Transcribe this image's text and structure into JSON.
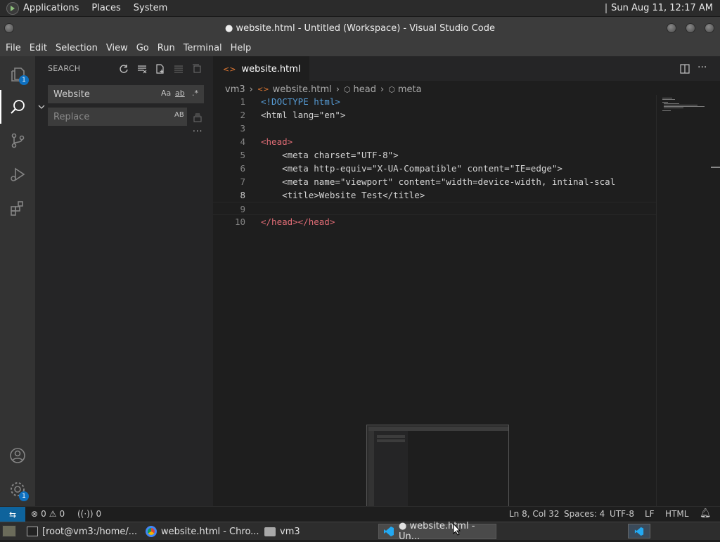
{
  "system": {
    "menus": [
      "Applications",
      "Places",
      "System"
    ],
    "clock": "Sun Aug 11, 12:17 AM"
  },
  "window": {
    "title": "● website.html - Untitled (Workspace) - Visual Studio Code"
  },
  "menubar": [
    "File",
    "Edit",
    "Selection",
    "View",
    "Go",
    "Run",
    "Terminal",
    "Help"
  ],
  "activity": {
    "explorer_badge": "1",
    "settings_badge": "1"
  },
  "sidebar": {
    "title": "SEARCH",
    "search_value": "Website",
    "replace_placeholder": "Replace",
    "match_case": "Aa",
    "whole_word": "ab",
    "regex": ".*",
    "preserve_case": "AB",
    "more": "..."
  },
  "editor": {
    "tab_label": "website.html",
    "breadcrumb": [
      "vm3",
      "website.html",
      "head",
      "meta"
    ],
    "lines": [
      {
        "num": "1",
        "text": "<!DOCTYPE html>"
      },
      {
        "num": "2",
        "text": "<html lang=\"en\">"
      },
      {
        "num": "3",
        "text": ""
      },
      {
        "num": "4",
        "text": "<head>"
      },
      {
        "num": "5",
        "text": "    <meta charset=\"UTF-8\">"
      },
      {
        "num": "6",
        "text": "    <meta http-equiv=\"X-UA-Compatible\" content=\"IE=edge\">"
      },
      {
        "num": "7",
        "text": "    <meta name=\"viewport\" content=\"width=device-width, intinal-scal"
      },
      {
        "num": "8",
        "text": "    <title>Website Test</title>"
      },
      {
        "num": "9",
        "text": ""
      },
      {
        "num": "10",
        "text": "</head></head>"
      }
    ]
  },
  "status": {
    "errors": "0",
    "warnings": "0",
    "ports": "0",
    "position": "Ln 8, Col 32",
    "spaces": "Spaces: 4",
    "encoding": "UTF-8",
    "eol": "LF",
    "language": "HTML"
  },
  "taskbar": {
    "items": [
      "[root@vm3:/home/...",
      "website.html - Chro...",
      "vm3",
      "● website.html - Un..."
    ]
  },
  "colors": {
    "accent": "#007acc",
    "badge": "#0e70c0",
    "editor_bg": "#1e1e1e",
    "sidebar_bg": "#252526"
  }
}
